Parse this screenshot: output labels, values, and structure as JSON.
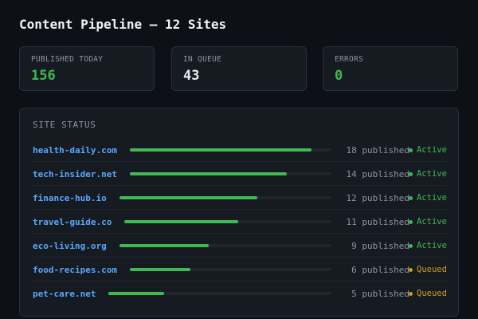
{
  "header": {
    "title": "Content Pipeline — 12 Sites"
  },
  "stats": [
    {
      "label": "PUBLISHED TODAY",
      "value": "156",
      "color": "#3fb950"
    },
    {
      "label": "IN QUEUE",
      "value": "43",
      "color": "#e6edf3"
    },
    {
      "label": "ERRORS",
      "value": "0",
      "color": "#3fb950"
    }
  ],
  "site_status": {
    "title": "SITE STATUS",
    "colors": {
      "active": "#3fb950",
      "queued": "#d29922"
    },
    "rows": [
      {
        "site": "health-daily.com",
        "count_text": "18 published",
        "published": 18,
        "progress": 0.9,
        "status": "Active",
        "status_type": "active"
      },
      {
        "site": "tech-insider.net",
        "count_text": "14 published",
        "published": 14,
        "progress": 0.78,
        "status": "Active",
        "status_type": "active"
      },
      {
        "site": "finance-hub.io",
        "count_text": "12 published",
        "published": 12,
        "progress": 0.65,
        "status": "Active",
        "status_type": "active"
      },
      {
        "site": "travel-guide.co",
        "count_text": "11 published",
        "published": 11,
        "progress": 0.55,
        "status": "Active",
        "status_type": "active"
      },
      {
        "site": "eco-living.org",
        "count_text": "9 published",
        "published": 9,
        "progress": 0.42,
        "status": "Active",
        "status_type": "active"
      },
      {
        "site": "food-recipes.com",
        "count_text": "6 published",
        "published": 6,
        "progress": 0.3,
        "status": "Queued",
        "status_type": "queued"
      },
      {
        "site": "pet-care.net",
        "count_text": "5 published",
        "published": 5,
        "progress": 0.25,
        "status": "Queued",
        "status_type": "queued"
      }
    ]
  }
}
